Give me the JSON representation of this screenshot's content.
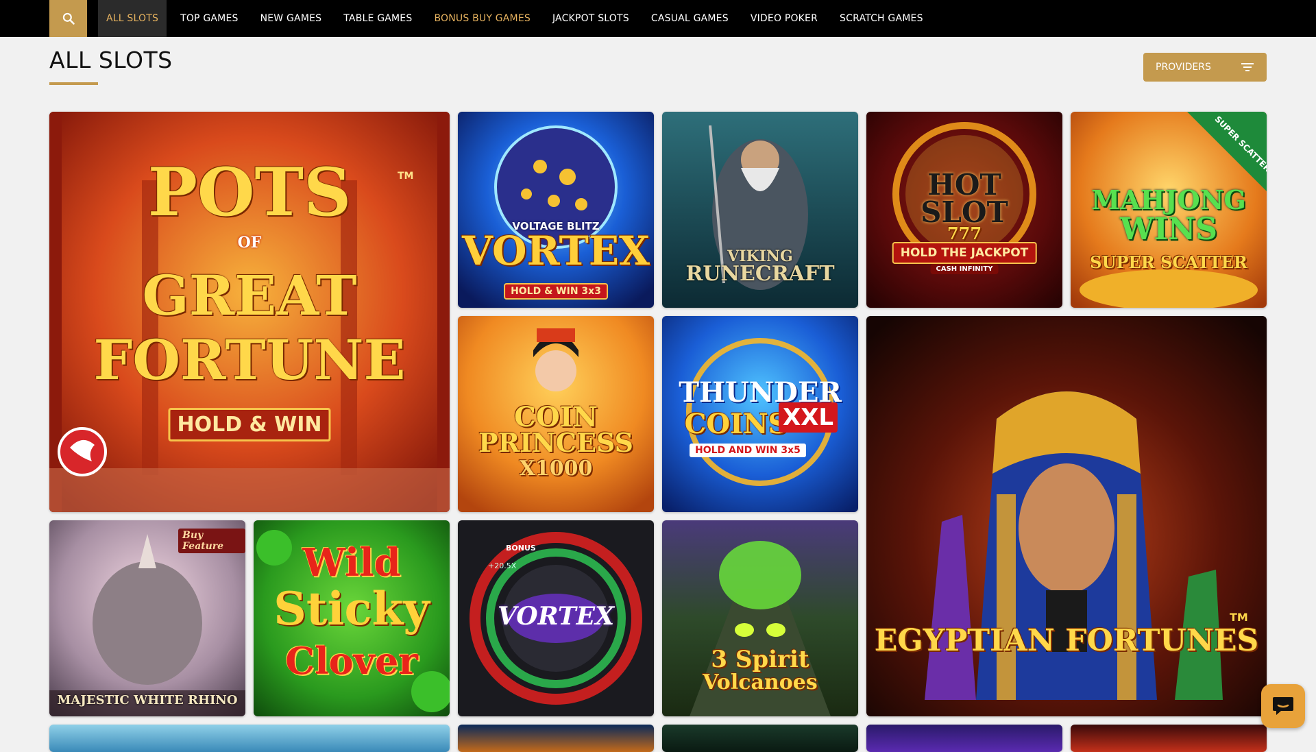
{
  "nav": {
    "items": [
      {
        "label": "ALL SLOTS"
      },
      {
        "label": "TOP GAMES"
      },
      {
        "label": "NEW GAMES"
      },
      {
        "label": "TABLE GAMES"
      },
      {
        "label": "BONUS BUY GAMES"
      },
      {
        "label": "JACKPOT SLOTS"
      },
      {
        "label": "CASUAL GAMES"
      },
      {
        "label": "VIDEO POKER"
      },
      {
        "label": "SCRATCH GAMES"
      }
    ],
    "active_label": "ALL SLOTS",
    "accent_color": "#c49a4e"
  },
  "page": {
    "title": "ALL SLOTS",
    "providers_label": "PROVIDERS"
  },
  "games": {
    "pots": {
      "title_line1": "POTS",
      "title_of": "OF",
      "title_line2": "GREAT",
      "title_line3": "FORTUNE",
      "banner": "HOLD & WIN",
      "tm": "TM"
    },
    "vortex_blitz": {
      "brand": "VOLTAGE BLITZ",
      "title": "VORTEX",
      "banner": "HOLD & WIN 3x3"
    },
    "viking": {
      "title_line1": "VIKING",
      "title_line2": "RUNECRAFT"
    },
    "hot_slot": {
      "title_line1": "HOT",
      "title_line2": "SLOT",
      "sevens": "777",
      "banner": "HOLD THE JACKPOT",
      "sub": "CASH INFINITY"
    },
    "mahjong": {
      "title_line1": "MAHJONG",
      "title_line2": "WINS",
      "sub": "SUPER SCATTER",
      "ribbon": "SUPER SCATTER"
    },
    "coin_princess": {
      "title_line1": "COIN",
      "title_line2": "PRINCESS",
      "sub": "X1000"
    },
    "thunder": {
      "title_line1": "THUNDER",
      "title_line2": "COINS",
      "xxl": "XXL",
      "sub": "HOLD AND WIN 3x5"
    },
    "egyptian": {
      "title": "EGYPTIAN FORTUNES",
      "tm": "TM"
    },
    "rhino": {
      "badge": "Buy Feature",
      "title": "MAJESTIC WHITE RHINO"
    },
    "wild_sticky": {
      "title_line1": "Wild",
      "title_line2": "Sticky",
      "title_line3": "Clover"
    },
    "vortex": {
      "title": "VORTEX",
      "bonus": "BONUS",
      "mult": "+20.5X"
    },
    "spirit": {
      "title_line1": "3 Spirit",
      "title_line2": "Volcanoes"
    }
  }
}
